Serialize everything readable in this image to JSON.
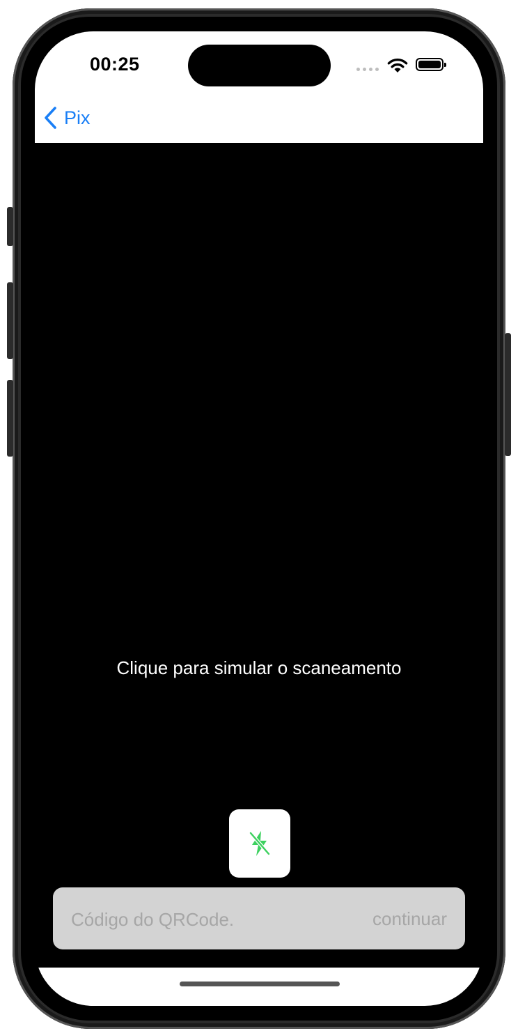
{
  "status_bar": {
    "time": "00:25",
    "icons": [
      "cellular-signal-icon",
      "wifi-icon",
      "battery-icon"
    ]
  },
  "nav": {
    "back_label": "Pix",
    "back_icon": "chevron-left-icon",
    "accent_color": "#1a7ff6"
  },
  "scanner": {
    "hint": "Clique para simular o scaneamento",
    "flash_icon": "flash-off-icon",
    "flash_icon_color": "#3dd15f"
  },
  "qr_entry": {
    "placeholder": "Código do QRCode.",
    "value": "",
    "continue_label": "continuar"
  }
}
